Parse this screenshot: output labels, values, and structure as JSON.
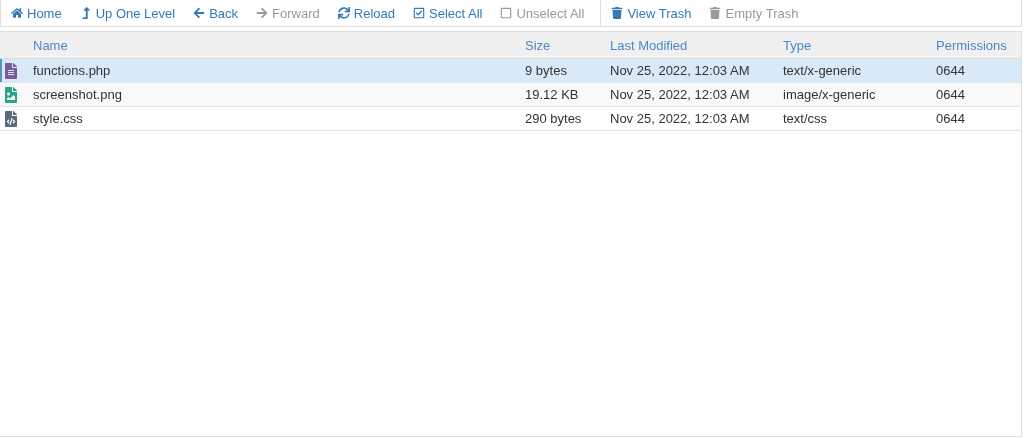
{
  "toolbar": {
    "groups": [
      [
        {
          "label": "Home",
          "kind": "home",
          "disabled": false
        },
        {
          "label": "Up One Level",
          "kind": "up",
          "disabled": false
        },
        {
          "label": "Back",
          "kind": "back",
          "disabled": false
        },
        {
          "label": "Forward",
          "kind": "forward",
          "disabled": true
        },
        {
          "label": "Reload",
          "kind": "reload",
          "disabled": false
        },
        {
          "label": "Select All",
          "kind": "check",
          "disabled": false
        },
        {
          "label": "Unselect All",
          "kind": "box",
          "disabled": true
        }
      ],
      [
        {
          "label": "View Trash",
          "kind": "trash",
          "disabled": false
        },
        {
          "label": "Empty Trash",
          "kind": "trash",
          "disabled": true
        }
      ]
    ]
  },
  "table": {
    "columns": [
      "Name",
      "Size",
      "Last Modified",
      "Type",
      "Permissions"
    ],
    "rows": [
      {
        "kind": "document",
        "selected": true,
        "cells": [
          "functions.php",
          "9 bytes",
          "Nov 25, 2022, 12:03 AM",
          "text/x-generic",
          "0644"
        ]
      },
      {
        "kind": "image",
        "selected": false,
        "cells": [
          "screenshot.png",
          "19.12 KB",
          "Nov 25, 2022, 12:03 AM",
          "image/x-generic",
          "0644"
        ]
      },
      {
        "kind": "code",
        "selected": false,
        "cells": [
          "style.css",
          "290 bytes",
          "Nov 25, 2022, 12:03 AM",
          "text/css",
          "0644"
        ]
      }
    ]
  }
}
